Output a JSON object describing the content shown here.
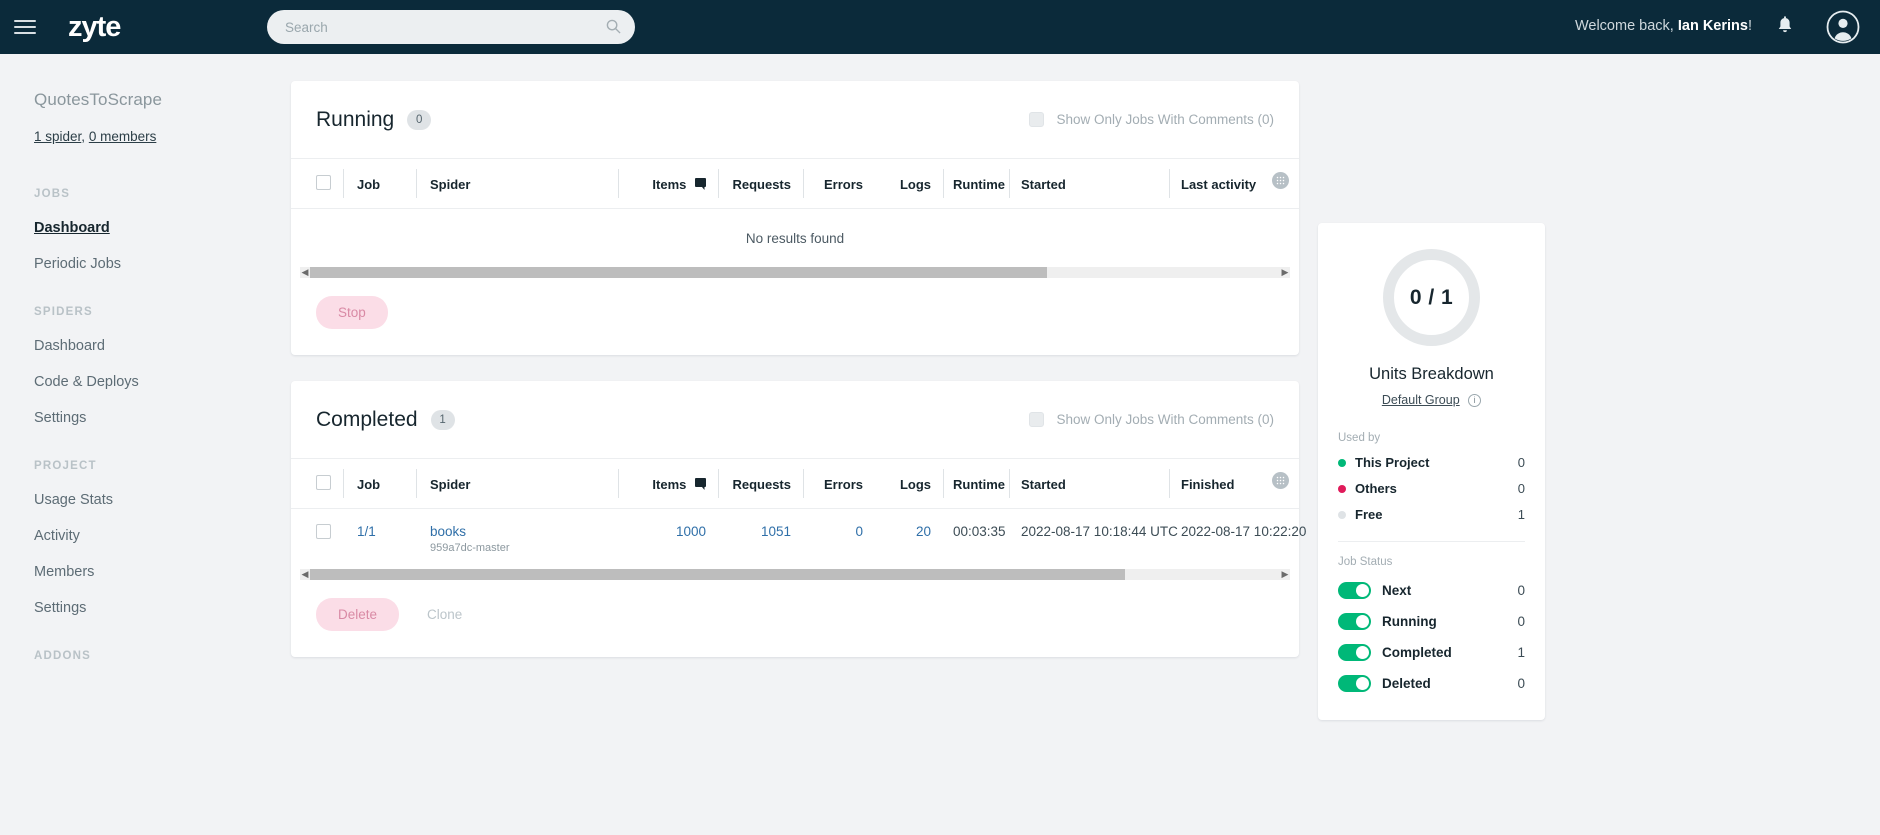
{
  "header": {
    "logo": "zyte",
    "search_placeholder": "Search",
    "welcome_prefix": "Welcome back, ",
    "user_name": "Ian Kerins",
    "welcome_suffix": "!"
  },
  "sidebar": {
    "project_name": "QuotesToScrape",
    "spiders_link": "1 spider",
    "meta_separator": ", ",
    "members_link": "0 members",
    "groups": [
      {
        "label": "JOBS",
        "items": [
          {
            "label": "Dashboard",
            "active": true
          },
          {
            "label": "Periodic Jobs",
            "active": false
          }
        ]
      },
      {
        "label": "SPIDERS",
        "items": [
          {
            "label": "Dashboard",
            "active": false
          },
          {
            "label": "Code & Deploys",
            "active": false
          },
          {
            "label": "Settings",
            "active": false
          }
        ]
      },
      {
        "label": "PROJECT",
        "items": [
          {
            "label": "Usage Stats",
            "active": false
          },
          {
            "label": "Activity",
            "active": false
          },
          {
            "label": "Members",
            "active": false
          },
          {
            "label": "Settings",
            "active": false
          }
        ]
      },
      {
        "label": "ADDONS",
        "items": []
      }
    ]
  },
  "running_card": {
    "title": "Running",
    "count": "0",
    "comments_filter_label": "Show Only Jobs With Comments (0)",
    "columns": [
      "Job",
      "Spider",
      "Items",
      "Requests",
      "Errors",
      "Logs",
      "Runtime",
      "Started",
      "Last activity"
    ],
    "empty_message": "No results found",
    "stop_label": "Stop",
    "scroll_thumb_pct": 76
  },
  "completed_card": {
    "title": "Completed",
    "count": "1",
    "comments_filter_label": "Show Only Jobs With Comments (0)",
    "columns": [
      "Job",
      "Spider",
      "Items",
      "Requests",
      "Errors",
      "Logs",
      "Runtime",
      "Started",
      "Finished"
    ],
    "rows": [
      {
        "job": "1/1",
        "spider": "books",
        "spider_sub": "959a7dc-master",
        "items": "1000",
        "requests": "1051",
        "errors": "0",
        "logs": "20",
        "runtime": "00:03:35",
        "started": "2022-08-17 10:18:44 UTC",
        "finished": "2022-08-17 10:22:20"
      }
    ],
    "delete_label": "Delete",
    "clone_label": "Clone",
    "scroll_thumb_pct": 84
  },
  "units_panel": {
    "donut_value": "0 / 1",
    "title": "Units Breakdown",
    "group_link": "Default Group",
    "used_by_label": "Used by",
    "used_by": [
      {
        "name": "This Project",
        "value": "0",
        "color": "#00b878"
      },
      {
        "name": "Others",
        "value": "0",
        "color": "#e01a5a"
      },
      {
        "name": "Free",
        "value": "1",
        "color": "#dfe3e6"
      }
    ],
    "job_status_label": "Job Status",
    "job_status": [
      {
        "name": "Next",
        "value": "0",
        "on": true
      },
      {
        "name": "Running",
        "value": "0",
        "on": true
      },
      {
        "name": "Completed",
        "value": "1",
        "on": true
      },
      {
        "name": "Deleted",
        "value": "0",
        "on": true
      }
    ]
  },
  "colors": {
    "brand_dark": "#0b2a3a",
    "accent_green": "#00b878",
    "accent_pink": "#e01a5a",
    "link_blue": "#2f6fa8"
  }
}
